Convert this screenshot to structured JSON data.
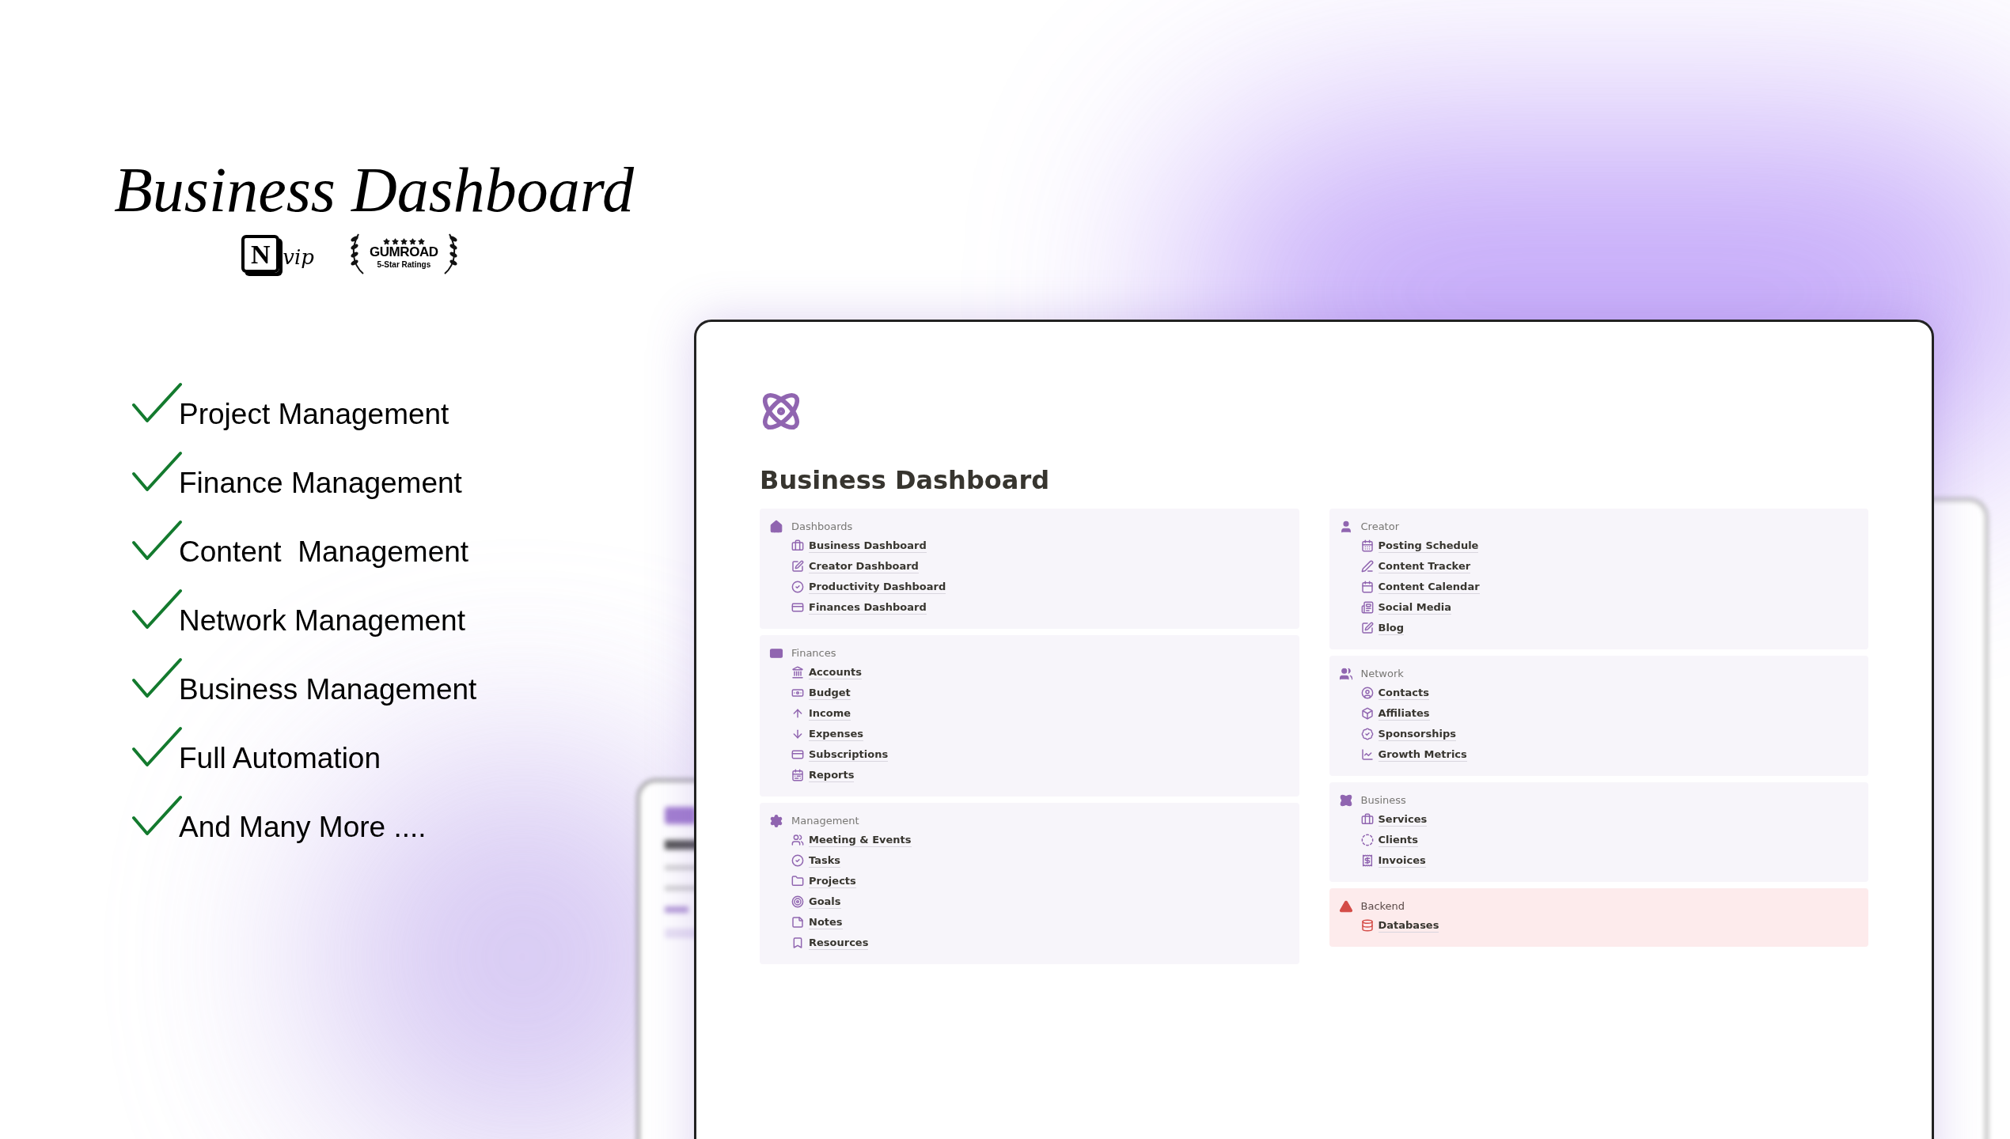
{
  "hero": {
    "title": "Business Dashboard",
    "badges": [
      {
        "kind": "notion",
        "letter": "N",
        "text": "vip"
      },
      {
        "kind": "gumroad",
        "stars": 5,
        "brand": "GUMROAD",
        "caption": "5-Star Ratings"
      }
    ]
  },
  "features": [
    {
      "label": "Project Management",
      "checked": true
    },
    {
      "label": "Finance Management",
      "checked": true
    },
    {
      "label": "Content  Management",
      "checked": true
    },
    {
      "label": "Network Management",
      "checked": true
    },
    {
      "label": "Business Management",
      "checked": true
    },
    {
      "label": "Full Automation",
      "checked": true
    },
    {
      "label": "And Many More ....",
      "checked": true
    }
  ],
  "window": {
    "title": "Business Dashboard",
    "columns": [
      {
        "sections": [
          {
            "heading": "Dashboards",
            "kind": "normal",
            "color": "#f7f5fa",
            "items": [
              {
                "label": "Business Dashboard"
              },
              {
                "label": "Creator Dashboard"
              },
              {
                "label": "Productivity Dashboard"
              },
              {
                "label": "Finances Dashboard"
              }
            ]
          },
          {
            "heading": "Finances",
            "kind": "normal",
            "color": "#f7f5fa",
            "items": [
              {
                "label": "Accounts"
              },
              {
                "label": "Budget"
              },
              {
                "label": "Income"
              },
              {
                "label": "Expenses"
              },
              {
                "label": "Subscriptions"
              },
              {
                "label": "Reports"
              }
            ]
          },
          {
            "heading": "Management",
            "kind": "normal",
            "color": "#f7f5fa",
            "items": [
              {
                "label": "Meeting & Events"
              },
              {
                "label": "Tasks"
              },
              {
                "label": "Projects"
              },
              {
                "label": "Goals"
              },
              {
                "label": "Notes"
              },
              {
                "label": "Resources"
              }
            ]
          }
        ]
      },
      {
        "sections": [
          {
            "heading": "Creator",
            "kind": "normal",
            "color": "#f7f5fa",
            "items": [
              {
                "label": "Posting Schedule"
              },
              {
                "label": "Content Tracker"
              },
              {
                "label": "Content Calendar"
              },
              {
                "label": "Social Media"
              },
              {
                "label": "Blog"
              }
            ]
          },
          {
            "heading": "Network",
            "kind": "normal",
            "color": "#f7f5fa",
            "items": [
              {
                "label": "Contacts"
              },
              {
                "label": "Affiliates"
              },
              {
                "label": "Sponsorships"
              },
              {
                "label": "Growth Metrics"
              }
            ]
          },
          {
            "heading": "Business",
            "kind": "normal",
            "color": "#f7f5fa",
            "items": [
              {
                "label": "Services"
              },
              {
                "label": "Clients"
              },
              {
                "label": "Invoices"
              }
            ]
          },
          {
            "heading": "Backend",
            "kind": "alert",
            "color": "#fdebec",
            "items": [
              {
                "label": "Databases"
              }
            ]
          }
        ]
      }
    ]
  }
}
